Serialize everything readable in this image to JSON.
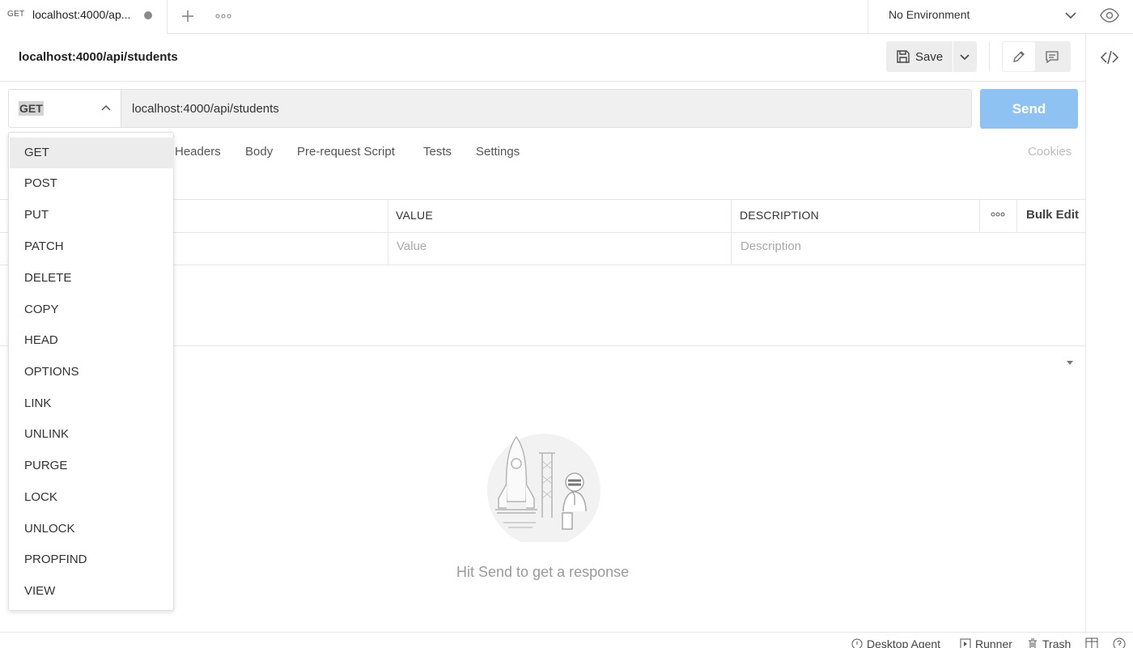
{
  "tab": {
    "method": "GET",
    "title": "localhost:4000/ap..."
  },
  "environment": {
    "selected": "No Environment"
  },
  "request": {
    "name": "localhost:4000/api/students",
    "method": "GET",
    "url": "localhost:4000/api/students"
  },
  "toolbar": {
    "save_label": "Save",
    "send_label": "Send"
  },
  "request_tabs": [
    "Headers",
    "Body",
    "Pre-request Script",
    "Tests",
    "Settings"
  ],
  "cookies_label": "Cookies",
  "params_table": {
    "columns": [
      "VALUE",
      "DESCRIPTION"
    ],
    "bulk_edit": "Bulk Edit",
    "value_placeholder": "Value",
    "description_placeholder": "Description"
  },
  "response": {
    "empty_message": "Hit Send to get a response"
  },
  "footer": {
    "desktop_agent": "Desktop Agent",
    "runner": "Runner",
    "trash": "Trash"
  },
  "method_menu": {
    "items": [
      "GET",
      "POST",
      "PUT",
      "PATCH",
      "DELETE",
      "COPY",
      "HEAD",
      "OPTIONS",
      "LINK",
      "UNLINK",
      "PURGE",
      "LOCK",
      "UNLOCK",
      "PROPFIND",
      "VIEW"
    ],
    "highlighted": "GET"
  },
  "colors": {
    "send_button": "#8ec2f3",
    "menu_highlight": "#ececec",
    "url_background": "#f0f0f0"
  },
  "icons": [
    "plus-icon",
    "more-horizontal-icon",
    "chevron-down-icon",
    "eye-icon",
    "code-icon",
    "save-icon",
    "pencil-icon",
    "comment-icon",
    "caret-down-icon",
    "info-icon",
    "play-icon",
    "trash-icon",
    "two-pane-icon",
    "help-icon"
  ]
}
